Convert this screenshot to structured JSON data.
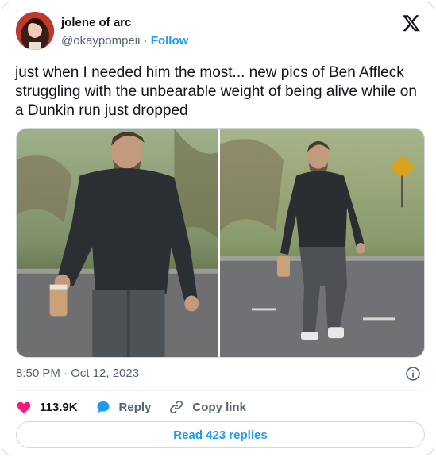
{
  "author": {
    "display_name": "jolene of arc",
    "handle": "@okaypompeii",
    "separator": "·",
    "follow_label": "Follow"
  },
  "tweet": {
    "text": "just when I needed him the most... new pics of Ben Affleck struggling with the unbearable weight of being alive while on a Dunkin run just dropped",
    "timestamp": "8:50 PM · Oct 12, 2023"
  },
  "actions": {
    "like_count": "113.9K",
    "reply_label": "Reply",
    "copy_link_label": "Copy link"
  },
  "read_replies_label": "Read 423 replies",
  "icons": {
    "logo": "x-logo-icon",
    "like": "heart-icon",
    "reply": "speech-bubble-icon",
    "copy": "link-icon",
    "info": "info-icon"
  },
  "colors": {
    "accent": "#1d9bf0",
    "like": "#f91880",
    "text": "#0f1419",
    "muted": "#536471",
    "border": "#cfd9de"
  }
}
